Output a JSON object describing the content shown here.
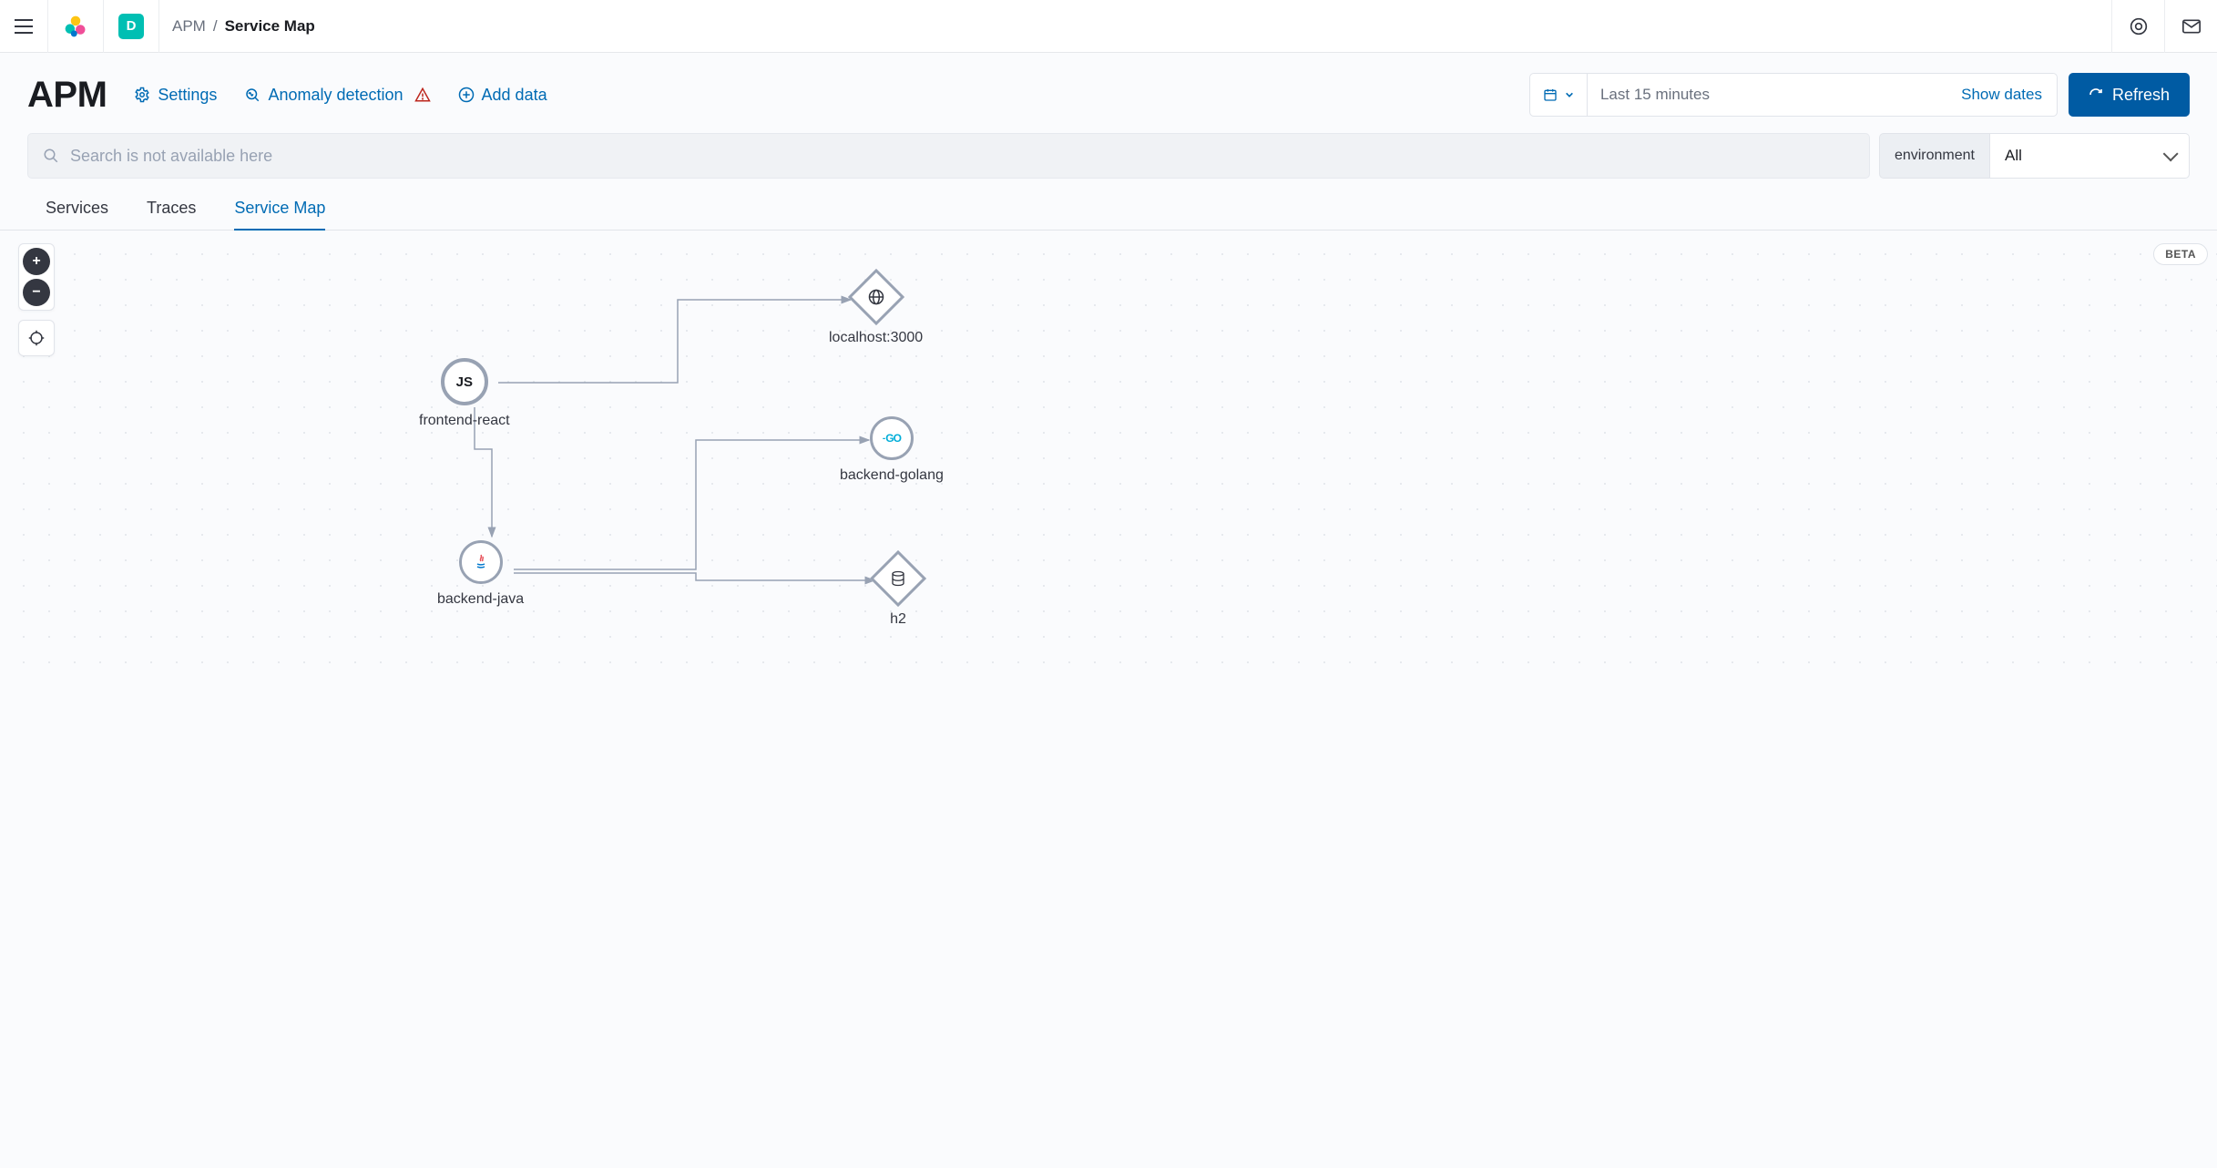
{
  "breadcrumb": {
    "root": "APM",
    "sep": "/",
    "current": "Service Map"
  },
  "header": {
    "title": "APM",
    "settings": "Settings",
    "anomaly": "Anomaly detection",
    "add_data": "Add data",
    "time_value": "Last 15 minutes",
    "show_dates": "Show dates",
    "refresh": "Refresh"
  },
  "search": {
    "placeholder": "Search is not available here"
  },
  "env": {
    "label": "environment",
    "value": "All"
  },
  "tabs": {
    "services": "Services",
    "traces": "Traces",
    "service_map": "Service Map"
  },
  "beta": "BETA",
  "space_badge": "D",
  "nodes": {
    "frontend": {
      "label": "frontend-react",
      "icon_text": "JS"
    },
    "backend_java": {
      "label": "backend-java"
    },
    "localhost": {
      "label": "localhost:3000"
    },
    "backend_golang": {
      "label": "backend-golang",
      "icon_text": "GO"
    },
    "h2": {
      "label": "h2"
    }
  }
}
